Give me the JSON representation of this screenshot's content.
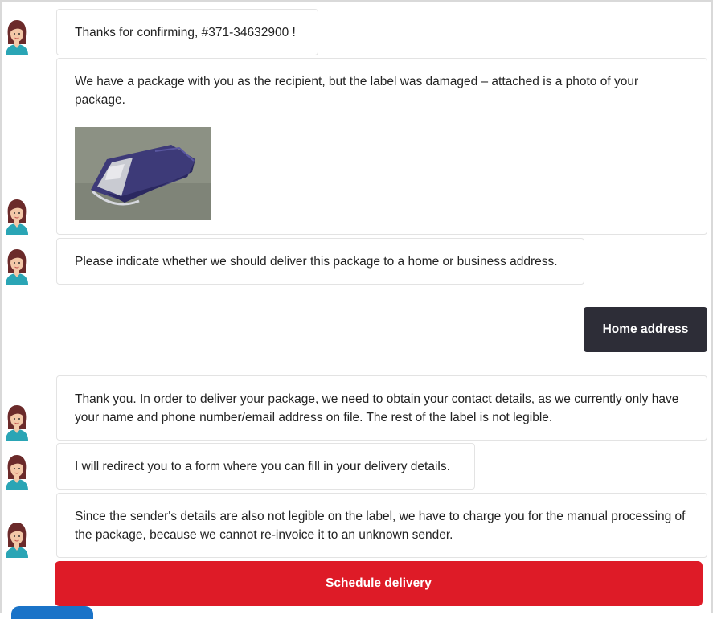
{
  "chat": {
    "messages": [
      {
        "text": "Thanks for confirming, #371-34632900 !"
      },
      {
        "text": "We have a package with you as the recipient, but the label was damaged – attached is a photo of your package."
      },
      {
        "text": "Please indicate whether we should deliver this package to a home or business address."
      },
      {
        "text": "Thank you. In order to deliver your package, we need to obtain your contact details, as we currently only have your name and phone number/email address on file. The rest of the label is not legible."
      },
      {
        "text": "I will redirect you to a form where you can fill in your delivery details."
      },
      {
        "text": "Since the sender's details are also not legible on the label, we have to charge you for the manual processing of the package, because we cannot re-invoice it to an unknown sender."
      }
    ],
    "user_reply": "Home address",
    "action_button": "Schedule delivery"
  },
  "colors": {
    "user_bubble": "#2d2d37",
    "action_button": "#de1b27"
  },
  "icons": {
    "agent_avatar": "agent-avatar-icon",
    "package_photo": "package-photo"
  }
}
